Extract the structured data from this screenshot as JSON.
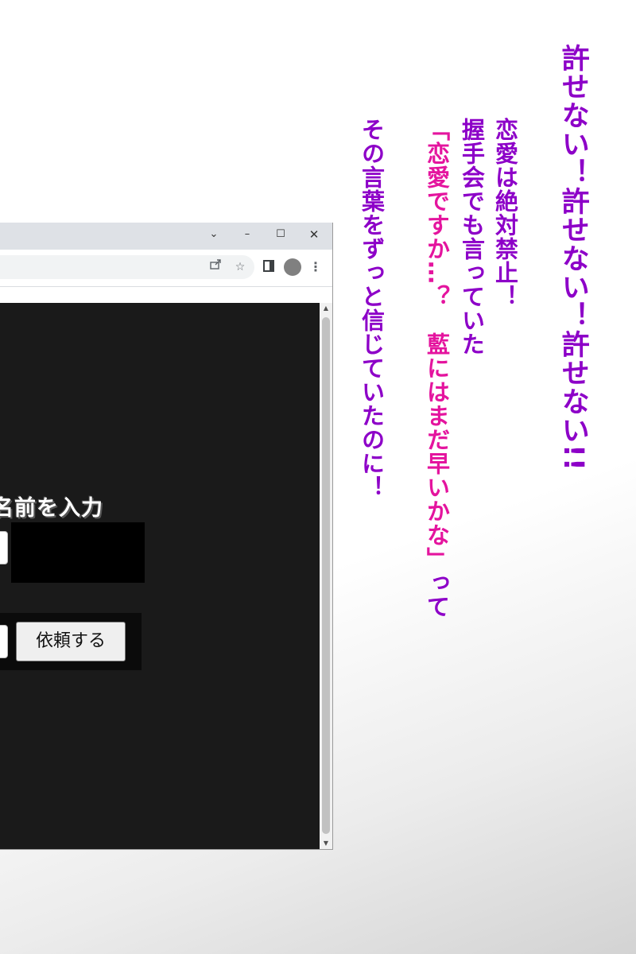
{
  "browser": {
    "window_controls": {
      "tabs_dropdown": "⌄",
      "minimize": "–",
      "maximize": "☐",
      "close": "✕"
    },
    "toolbar_icons": [
      "share-icon",
      "star-icon",
      "side-panel-icon",
      "profile-avatar",
      "menu-icon"
    ],
    "page": {
      "heading": "名前を入力",
      "request_button_label": "依頼する"
    }
  },
  "captions": {
    "col1": "許せない！許せない！許せない!!",
    "col2": "恋愛は絶対禁止！",
    "col3": "握手会でも言っていた",
    "col4_pink": "「恋愛ですか…？　藍にはまだ早いかな」",
    "col4_tail": "って",
    "col5": "その言葉をずっと信じていたのに！"
  },
  "colors": {
    "caption_purple": "#8d00c8",
    "caption_pink": "#e4149e",
    "page_background": "#1a1a1a"
  }
}
